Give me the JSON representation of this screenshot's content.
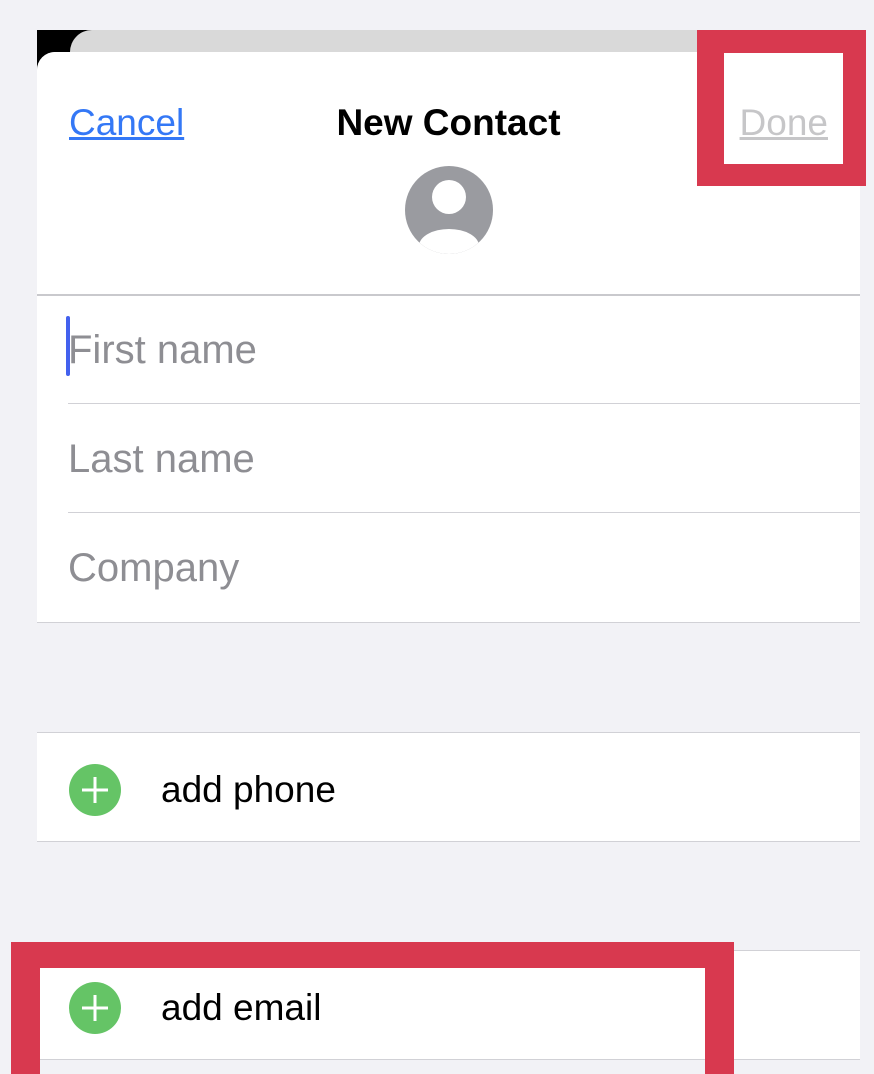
{
  "header": {
    "cancel_label": "Cancel",
    "title": "New Contact",
    "done_label": "Done"
  },
  "fields": {
    "first_name_placeholder": "First name",
    "last_name_placeholder": "Last name",
    "company_placeholder": "Company"
  },
  "rows": {
    "add_phone_label": "add phone",
    "add_email_label": "add email"
  },
  "icons": {
    "avatar": "person-silhouette-icon",
    "add": "green-plus-circle-icon"
  },
  "colors": {
    "link_blue": "#3478f6",
    "done_disabled": "#c6c6c8",
    "add_green": "#65c466",
    "highlight_red": "#d8394f",
    "avatar_gray": "#9a9ba0"
  }
}
